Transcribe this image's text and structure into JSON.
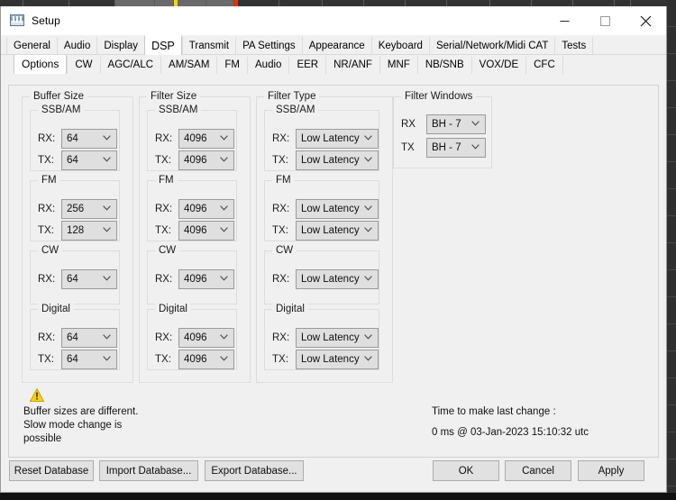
{
  "window": {
    "title": "Setup",
    "icon": "radio-setup-icon",
    "controls": {
      "minimize": "minimize-icon",
      "maximize": "maximize-icon",
      "close": "close-icon"
    }
  },
  "tabs_primary": [
    {
      "label": "General",
      "active": false
    },
    {
      "label": "Audio",
      "active": false
    },
    {
      "label": "Display",
      "active": false
    },
    {
      "label": "DSP",
      "active": true
    },
    {
      "label": "Transmit",
      "active": false
    },
    {
      "label": "PA Settings",
      "active": false
    },
    {
      "label": "Appearance",
      "active": false
    },
    {
      "label": "Keyboard",
      "active": false
    },
    {
      "label": "Serial/Network/Midi CAT",
      "active": false
    },
    {
      "label": "Tests",
      "active": false
    }
  ],
  "tabs_secondary": [
    {
      "label": "Options",
      "active": true
    },
    {
      "label": "CW",
      "active": false
    },
    {
      "label": "AGC/ALC",
      "active": false
    },
    {
      "label": "AM/SAM",
      "active": false
    },
    {
      "label": "FM",
      "active": false
    },
    {
      "label": "Audio",
      "active": false
    },
    {
      "label": "EER",
      "active": false
    },
    {
      "label": "NR/ANF",
      "active": false
    },
    {
      "label": "MNF",
      "active": false
    },
    {
      "label": "NB/SNB",
      "active": false
    },
    {
      "label": "VOX/DE",
      "active": false
    },
    {
      "label": "CFC",
      "active": false
    }
  ],
  "groups": {
    "buffer_size": {
      "title": "Buffer Size",
      "sections": [
        {
          "title": "SSB/AM",
          "rows": [
            {
              "label": "RX:",
              "value": "64"
            },
            {
              "label": "TX:",
              "value": "64"
            }
          ]
        },
        {
          "title": "FM",
          "rows": [
            {
              "label": "RX:",
              "value": "256"
            },
            {
              "label": "TX:",
              "value": "128"
            }
          ]
        },
        {
          "title": "CW",
          "rows": [
            {
              "label": "RX:",
              "value": "64"
            }
          ]
        },
        {
          "title": "Digital",
          "rows": [
            {
              "label": "RX:",
              "value": "64"
            },
            {
              "label": "TX:",
              "value": "64"
            }
          ]
        }
      ]
    },
    "filter_size": {
      "title": "Filter Size",
      "sections": [
        {
          "title": "SSB/AM",
          "rows": [
            {
              "label": "RX:",
              "value": "4096"
            },
            {
              "label": "TX:",
              "value": "4096"
            }
          ]
        },
        {
          "title": "FM",
          "rows": [
            {
              "label": "RX:",
              "value": "4096"
            },
            {
              "label": "TX:",
              "value": "4096"
            }
          ]
        },
        {
          "title": "CW",
          "rows": [
            {
              "label": "RX:",
              "value": "4096"
            }
          ]
        },
        {
          "title": "Digital",
          "rows": [
            {
              "label": "RX:",
              "value": "4096"
            },
            {
              "label": "TX:",
              "value": "4096"
            }
          ]
        }
      ]
    },
    "filter_type": {
      "title": "Filter Type",
      "sections": [
        {
          "title": "SSB/AM",
          "rows": [
            {
              "label": "RX:",
              "value": "Low Latency"
            },
            {
              "label": "TX:",
              "value": "Low Latency"
            }
          ]
        },
        {
          "title": "FM",
          "rows": [
            {
              "label": "RX:",
              "value": "Low Latency"
            },
            {
              "label": "TX:",
              "value": "Low Latency"
            }
          ]
        },
        {
          "title": "CW",
          "rows": [
            {
              "label": "RX:",
              "value": "Low Latency"
            }
          ]
        },
        {
          "title": "Digital",
          "rows": [
            {
              "label": "RX:",
              "value": "Low Latency"
            },
            {
              "label": "TX:",
              "value": "Low Latency"
            }
          ]
        }
      ]
    },
    "filter_windows": {
      "title": "Filter Windows",
      "rows": [
        {
          "label": "RX",
          "value": "BH - 7"
        },
        {
          "label": "TX",
          "value": "BH - 7"
        }
      ]
    }
  },
  "warning": {
    "icon": "warning-triangle-icon",
    "text": "Buffer sizes are different. Slow mode change is possible",
    "color": "#f5c518"
  },
  "timing": {
    "label": "Time to make last change :",
    "value": "0 ms @ 03-Jan-2023 15:10:32 utc"
  },
  "footer": {
    "reset_database": "Reset Database",
    "import_database": "Import Database...",
    "export_database": "Export Database...",
    "ok": "OK",
    "cancel": "Cancel",
    "apply": "Apply"
  }
}
